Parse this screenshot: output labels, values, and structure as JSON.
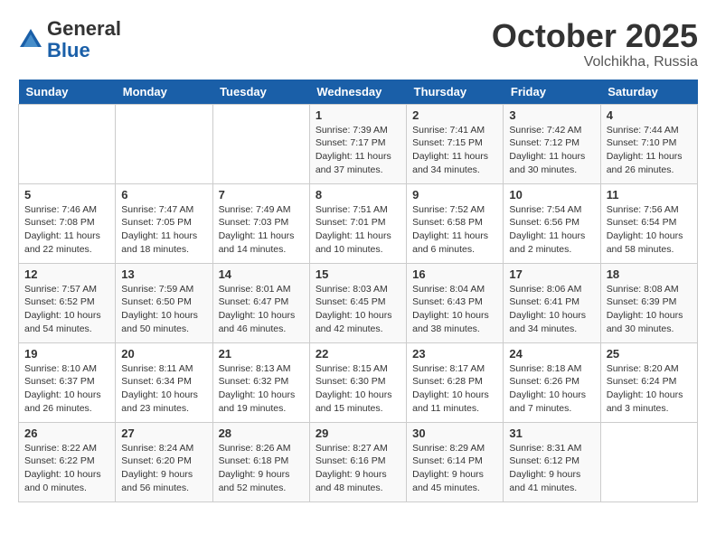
{
  "header": {
    "logo_line1": "General",
    "logo_line2": "Blue",
    "month_title": "October 2025",
    "location": "Volchikha, Russia"
  },
  "weekdays": [
    "Sunday",
    "Monday",
    "Tuesday",
    "Wednesday",
    "Thursday",
    "Friday",
    "Saturday"
  ],
  "weeks": [
    [
      {
        "day": "",
        "info": ""
      },
      {
        "day": "",
        "info": ""
      },
      {
        "day": "",
        "info": ""
      },
      {
        "day": "1",
        "info": "Sunrise: 7:39 AM\nSunset: 7:17 PM\nDaylight: 11 hours\nand 37 minutes."
      },
      {
        "day": "2",
        "info": "Sunrise: 7:41 AM\nSunset: 7:15 PM\nDaylight: 11 hours\nand 34 minutes."
      },
      {
        "day": "3",
        "info": "Sunrise: 7:42 AM\nSunset: 7:12 PM\nDaylight: 11 hours\nand 30 minutes."
      },
      {
        "day": "4",
        "info": "Sunrise: 7:44 AM\nSunset: 7:10 PM\nDaylight: 11 hours\nand 26 minutes."
      }
    ],
    [
      {
        "day": "5",
        "info": "Sunrise: 7:46 AM\nSunset: 7:08 PM\nDaylight: 11 hours\nand 22 minutes."
      },
      {
        "day": "6",
        "info": "Sunrise: 7:47 AM\nSunset: 7:05 PM\nDaylight: 11 hours\nand 18 minutes."
      },
      {
        "day": "7",
        "info": "Sunrise: 7:49 AM\nSunset: 7:03 PM\nDaylight: 11 hours\nand 14 minutes."
      },
      {
        "day": "8",
        "info": "Sunrise: 7:51 AM\nSunset: 7:01 PM\nDaylight: 11 hours\nand 10 minutes."
      },
      {
        "day": "9",
        "info": "Sunrise: 7:52 AM\nSunset: 6:58 PM\nDaylight: 11 hours\nand 6 minutes."
      },
      {
        "day": "10",
        "info": "Sunrise: 7:54 AM\nSunset: 6:56 PM\nDaylight: 11 hours\nand 2 minutes."
      },
      {
        "day": "11",
        "info": "Sunrise: 7:56 AM\nSunset: 6:54 PM\nDaylight: 10 hours\nand 58 minutes."
      }
    ],
    [
      {
        "day": "12",
        "info": "Sunrise: 7:57 AM\nSunset: 6:52 PM\nDaylight: 10 hours\nand 54 minutes."
      },
      {
        "day": "13",
        "info": "Sunrise: 7:59 AM\nSunset: 6:50 PM\nDaylight: 10 hours\nand 50 minutes."
      },
      {
        "day": "14",
        "info": "Sunrise: 8:01 AM\nSunset: 6:47 PM\nDaylight: 10 hours\nand 46 minutes."
      },
      {
        "day": "15",
        "info": "Sunrise: 8:03 AM\nSunset: 6:45 PM\nDaylight: 10 hours\nand 42 minutes."
      },
      {
        "day": "16",
        "info": "Sunrise: 8:04 AM\nSunset: 6:43 PM\nDaylight: 10 hours\nand 38 minutes."
      },
      {
        "day": "17",
        "info": "Sunrise: 8:06 AM\nSunset: 6:41 PM\nDaylight: 10 hours\nand 34 minutes."
      },
      {
        "day": "18",
        "info": "Sunrise: 8:08 AM\nSunset: 6:39 PM\nDaylight: 10 hours\nand 30 minutes."
      }
    ],
    [
      {
        "day": "19",
        "info": "Sunrise: 8:10 AM\nSunset: 6:37 PM\nDaylight: 10 hours\nand 26 minutes."
      },
      {
        "day": "20",
        "info": "Sunrise: 8:11 AM\nSunset: 6:34 PM\nDaylight: 10 hours\nand 23 minutes."
      },
      {
        "day": "21",
        "info": "Sunrise: 8:13 AM\nSunset: 6:32 PM\nDaylight: 10 hours\nand 19 minutes."
      },
      {
        "day": "22",
        "info": "Sunrise: 8:15 AM\nSunset: 6:30 PM\nDaylight: 10 hours\nand 15 minutes."
      },
      {
        "day": "23",
        "info": "Sunrise: 8:17 AM\nSunset: 6:28 PM\nDaylight: 10 hours\nand 11 minutes."
      },
      {
        "day": "24",
        "info": "Sunrise: 8:18 AM\nSunset: 6:26 PM\nDaylight: 10 hours\nand 7 minutes."
      },
      {
        "day": "25",
        "info": "Sunrise: 8:20 AM\nSunset: 6:24 PM\nDaylight: 10 hours\nand 3 minutes."
      }
    ],
    [
      {
        "day": "26",
        "info": "Sunrise: 8:22 AM\nSunset: 6:22 PM\nDaylight: 10 hours\nand 0 minutes."
      },
      {
        "day": "27",
        "info": "Sunrise: 8:24 AM\nSunset: 6:20 PM\nDaylight: 9 hours\nand 56 minutes."
      },
      {
        "day": "28",
        "info": "Sunrise: 8:26 AM\nSunset: 6:18 PM\nDaylight: 9 hours\nand 52 minutes."
      },
      {
        "day": "29",
        "info": "Sunrise: 8:27 AM\nSunset: 6:16 PM\nDaylight: 9 hours\nand 48 minutes."
      },
      {
        "day": "30",
        "info": "Sunrise: 8:29 AM\nSunset: 6:14 PM\nDaylight: 9 hours\nand 45 minutes."
      },
      {
        "day": "31",
        "info": "Sunrise: 8:31 AM\nSunset: 6:12 PM\nDaylight: 9 hours\nand 41 minutes."
      },
      {
        "day": "",
        "info": ""
      }
    ]
  ]
}
